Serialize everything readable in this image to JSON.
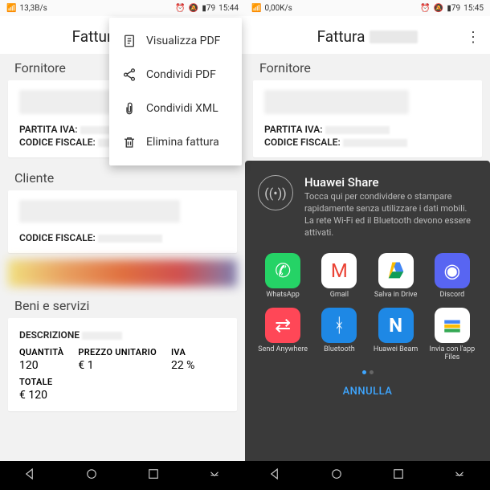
{
  "left": {
    "status": {
      "rate": "13,3B/s",
      "battery": "79",
      "time": "15:44"
    },
    "header": {
      "title": "Fattura"
    },
    "menu": [
      {
        "label": "Visualizza PDF"
      },
      {
        "label": "Condividi PDF"
      },
      {
        "label": "Condividi XML"
      },
      {
        "label": "Elimina fattura"
      }
    ],
    "sections": {
      "supplier": "Fornitore",
      "vat": "PARTITA IVA:",
      "taxcode": "CODICE FISCALE:",
      "client": "Cliente",
      "client_taxcode": "CODICE FISCALE:",
      "goods": "Beni e servizi",
      "descrizione": "DESCRIZIONE",
      "qty_h": "QUANTITÀ",
      "qty_v": "120",
      "price_h": "PREZZO UNITARIO",
      "price_v": "€ 1",
      "iva_h": "IVA",
      "iva_v": "22 %",
      "tot_h": "TOTALE",
      "tot_v": "€ 120"
    }
  },
  "right": {
    "status": {
      "rate": "0,00K/s",
      "battery": "79",
      "time": "15:45"
    },
    "header": {
      "title": "Fattura"
    },
    "sections": {
      "supplier": "Fornitore",
      "vat": "PARTITA IVA:",
      "taxcode": "CODICE FISCALE:"
    },
    "share": {
      "title": "Huawei Share",
      "desc": "Tocca qui per condividere o stampare rapidamente senza utilizzare i dati mobili. La rete Wi-Fi ed il Bluetooth devono essere attivati.",
      "apps": [
        {
          "name": "WhatsApp"
        },
        {
          "name": "Gmail"
        },
        {
          "name": "Salva in Drive"
        },
        {
          "name": "Discord"
        },
        {
          "name": "Send Anywhere"
        },
        {
          "name": "Bluetooth"
        },
        {
          "name": "Huawei Beam"
        },
        {
          "name": "Invia con l'app Files"
        }
      ],
      "cancel": "ANNULLA"
    }
  }
}
